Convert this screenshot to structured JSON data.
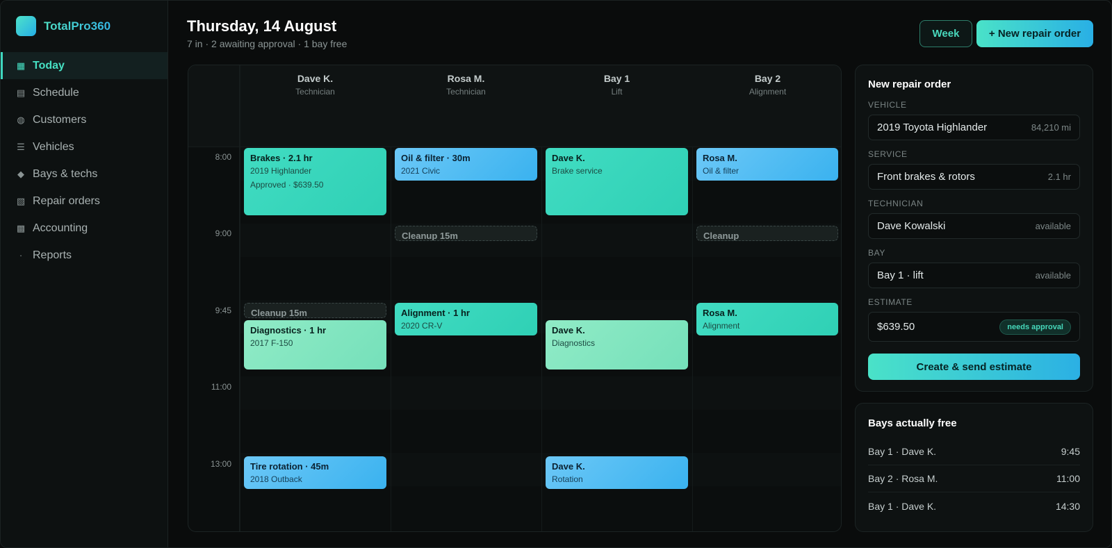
{
  "app": {
    "name": "TotalPro360"
  },
  "sidebar": {
    "items": [
      {
        "label": "Today",
        "icon": "▦",
        "active": true
      },
      {
        "label": "Schedule",
        "icon": "▤",
        "active": false
      },
      {
        "label": "Customers",
        "icon": "◍",
        "active": false
      },
      {
        "label": "Vehicles",
        "icon": "☰",
        "active": false
      },
      {
        "label": "Bays & techs",
        "icon": "◆",
        "active": false
      },
      {
        "label": "Repair orders",
        "icon": "▧",
        "active": false
      },
      {
        "label": "Accounting",
        "icon": "▩",
        "active": false
      },
      {
        "label": "Reports",
        "icon": "·",
        "active": false
      }
    ]
  },
  "header": {
    "title": "Thursday, 14 August",
    "subtitle": "7 in · 2 awaiting approval · 1 bay free",
    "week_label": "Week",
    "new_label": "+ New repair order"
  },
  "calendar": {
    "columns": [
      {
        "name": "Dave K.",
        "role": "Technician"
      },
      {
        "name": "Rosa M.",
        "role": "Technician"
      },
      {
        "name": "Bay 1",
        "role": "Lift"
      },
      {
        "name": "Bay 2",
        "role": "Alignment"
      }
    ],
    "times": [
      "8:00",
      "9:00",
      "9:45",
      "11:00",
      "13:00"
    ],
    "events": {
      "brakes": {
        "title": "Brakes · 2.1 hr",
        "sub": "2019 Highlander",
        "extra": "Approved · $639.50"
      },
      "oil": {
        "title": "Oil & filter · 30m",
        "sub": "2021 Civic"
      },
      "bay1_brake": {
        "title": "Dave K.",
        "sub": "Brake service"
      },
      "bay2_oil": {
        "title": "Rosa M.",
        "sub": "Oil & filter"
      },
      "cleanup_rosa": {
        "title": "Cleanup 15m"
      },
      "cleanup_bay2": {
        "title": "Cleanup"
      },
      "cleanup_dave": {
        "title": "Cleanup 15m"
      },
      "diag": {
        "title": "Diagnostics · 1 hr",
        "sub": "2017 F-150"
      },
      "align": {
        "title": "Alignment · 1 hr",
        "sub": "2020 CR-V"
      },
      "bay1_diag": {
        "title": "Dave K.",
        "sub": "Diagnostics"
      },
      "bay2_align": {
        "title": "Rosa M.",
        "sub": "Alignment"
      },
      "tire": {
        "title": "Tire rotation · 45m",
        "sub": "2018 Outback"
      },
      "bay1_rot": {
        "title": "Dave K.",
        "sub": "Rotation"
      }
    }
  },
  "repair_order": {
    "title": "New repair order",
    "vehicle": {
      "label": "VEHICLE",
      "value": "2019 Toyota Highlander",
      "meta": "84,210 mi"
    },
    "service": {
      "label": "SERVICE",
      "value": "Front brakes & rotors",
      "meta": "2.1 hr"
    },
    "technician": {
      "label": "TECHNICIAN",
      "value": "Dave Kowalski",
      "meta": "available"
    },
    "bay": {
      "label": "BAY",
      "value": "Bay 1 · lift",
      "meta": "available"
    },
    "estimate": {
      "label": "ESTIMATE",
      "value": "$639.50",
      "badge": "needs approval"
    },
    "submit_label": "Create & send estimate"
  },
  "bays_free": {
    "title": "Bays actually free",
    "rows": [
      {
        "label": "Bay 1 · Dave K.",
        "time": "9:45"
      },
      {
        "label": "Bay 2 · Rosa M.",
        "time": "11:00"
      },
      {
        "label": "Bay 1 · Dave K.",
        "time": "14:30"
      }
    ]
  },
  "colors": {
    "accent": "#46e0c3",
    "accent_blue": "#29afe5",
    "background": "#0a0c0c"
  }
}
